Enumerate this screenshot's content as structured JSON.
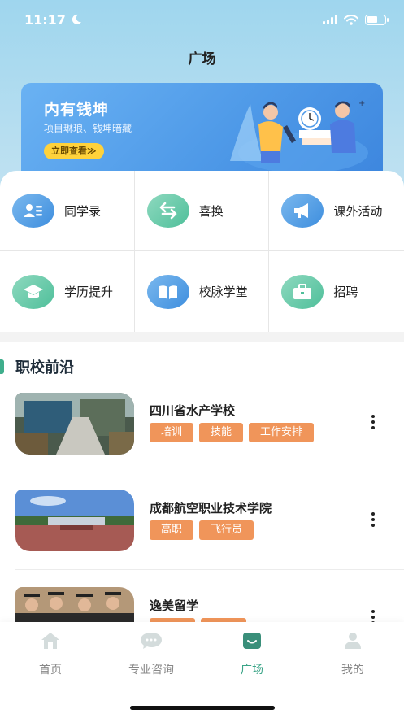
{
  "status": {
    "time": "11:17"
  },
  "header": {
    "title": "广场"
  },
  "banner": {
    "title": "内有钱坤",
    "subtitle": "项目琳琅、钱坤暗藏",
    "button": "立即查看≫"
  },
  "grid": [
    {
      "label": "同学录",
      "icon": "contacts-icon",
      "color": "blue"
    },
    {
      "label": "喜换",
      "icon": "exchange-arrows-icon",
      "color": "green"
    },
    {
      "label": "课外活动",
      "icon": "megaphone-icon",
      "color": "blue"
    },
    {
      "label": "学历提升",
      "icon": "graduation-cap-icon",
      "color": "green"
    },
    {
      "label": "校脉学堂",
      "icon": "open-book-icon",
      "color": "blue"
    },
    {
      "label": "招聘",
      "icon": "briefcase-icon",
      "color": "green"
    }
  ],
  "section": {
    "title": "职校前沿"
  },
  "schools": [
    {
      "name": "四川省水产学校",
      "tags": [
        "培训",
        "技能",
        "工作安排"
      ]
    },
    {
      "name": "成都航空职业技术学院",
      "tags": [
        "高职",
        "飞行员"
      ]
    },
    {
      "name": "逸美留学",
      "tags": [
        "",
        ""
      ]
    }
  ],
  "tabs": [
    {
      "label": "首页",
      "icon": "home-icon"
    },
    {
      "label": "专业咨询",
      "icon": "chat-bubble-icon"
    },
    {
      "label": "广场",
      "icon": "square-smile-icon"
    },
    {
      "label": "我的",
      "icon": "user-icon"
    }
  ],
  "colors": {
    "accent": "#3aa487",
    "tag": "#f0955a",
    "banner_btn": "#ffd23b"
  }
}
